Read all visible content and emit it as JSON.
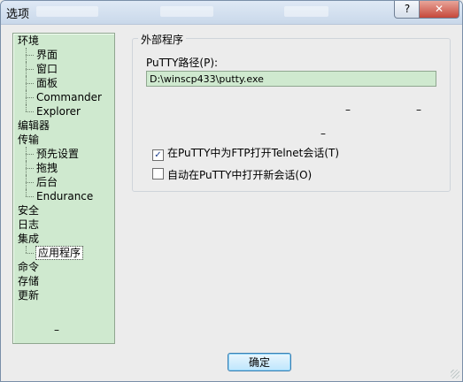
{
  "window": {
    "title": "选项"
  },
  "titlebar": {
    "help_label": "?",
    "close_label": "✕"
  },
  "tree": {
    "items": [
      {
        "label": "环境",
        "level": 0
      },
      {
        "label": "界面",
        "level": 1
      },
      {
        "label": "窗口",
        "level": 1
      },
      {
        "label": "面板",
        "level": 1
      },
      {
        "label": "Commander",
        "level": 1
      },
      {
        "label": "Explorer",
        "level": 1
      },
      {
        "label": "编辑器",
        "level": 0
      },
      {
        "label": "传输",
        "level": 0
      },
      {
        "label": "预先设置",
        "level": 1
      },
      {
        "label": "拖拽",
        "level": 1
      },
      {
        "label": "后台",
        "level": 1
      },
      {
        "label": "Endurance",
        "level": 1
      },
      {
        "label": "安全",
        "level": 0
      },
      {
        "label": "日志",
        "level": 0
      },
      {
        "label": "集成",
        "level": 0
      },
      {
        "label": "应用程序",
        "level": 1,
        "selected": true
      },
      {
        "label": "命令",
        "level": 0
      },
      {
        "label": "存储",
        "level": 0
      },
      {
        "label": "更新",
        "level": 0
      }
    ],
    "trailing_glyph": "–"
  },
  "group": {
    "legend": "外部程序",
    "putty_path_label": "PuTTY路径(P):",
    "putty_path_value": "D:\\winscp433\\putty.exe",
    "glyph_a": "–",
    "glyph_b": "–",
    "glyph_c": "–",
    "option_telnet": {
      "label": "在PuTTY中为FTP打开Telnet会话(T)",
      "checked": true,
      "check_glyph": "✓"
    },
    "option_new_session": {
      "label": "自动在PuTTY中打开新会话(O)",
      "checked": false,
      "check_glyph": ""
    }
  },
  "footer": {
    "ok_label": "确定"
  },
  "colors": {
    "tree_bg": "#cfe9cf",
    "input_bg": "#cfe9cf",
    "button_border": "#3c7fb1"
  }
}
